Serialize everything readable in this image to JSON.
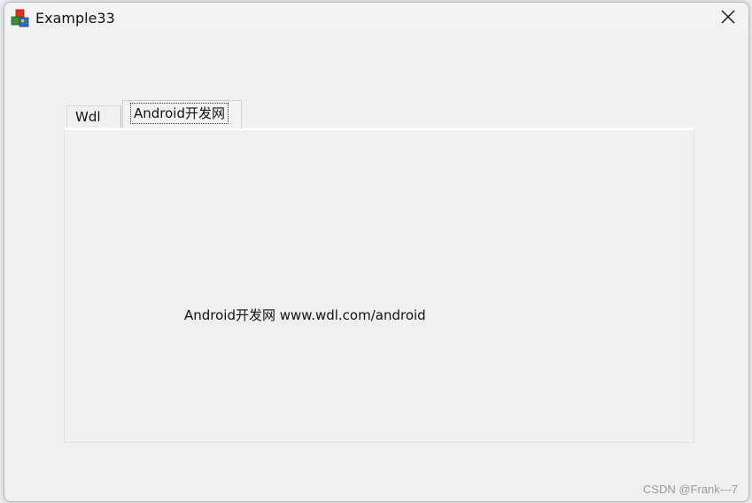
{
  "window": {
    "title": "Example33",
    "close_symbol": "✕"
  },
  "tabs": [
    {
      "label": "Wdl",
      "selected": false
    },
    {
      "label": "Android开发网",
      "selected": true
    }
  ],
  "panel": {
    "text": "Android开发网 www.wdl.com/android"
  },
  "watermark": {
    "text": "CSDN @Frank---7"
  },
  "colors": {
    "window_bg": "#f0f0f0",
    "titlebar_bg": "#f3f3f3",
    "text": "#111111",
    "watermark": "#9a9a9a"
  },
  "icons": {
    "app": "app-blocks-icon",
    "close": "close-icon"
  }
}
